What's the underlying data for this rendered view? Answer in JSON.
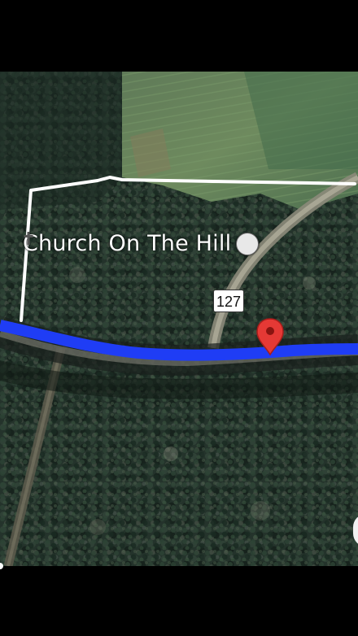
{
  "map": {
    "view": "satellite",
    "place": {
      "name": "Church On The Hill",
      "icon": "church-cross-icon"
    },
    "road_shield": {
      "label": "127"
    },
    "pin": {
      "icon": "red-location-pin-icon",
      "color": "#e53935"
    },
    "route": {
      "color": "#1f3df5"
    },
    "boundary": {
      "color": "#ffffff"
    }
  }
}
